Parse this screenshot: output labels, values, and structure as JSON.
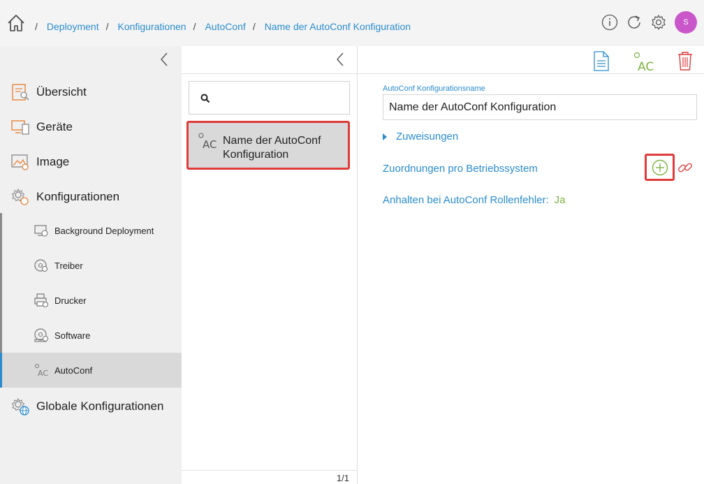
{
  "breadcrumb": {
    "items": [
      "Deployment",
      "Konfigurationen",
      "AutoConf",
      "Name der AutoConf Konfiguration"
    ],
    "separator": "/"
  },
  "header": {
    "icons": [
      "info-icon",
      "refresh-icon",
      "gear-icon"
    ],
    "avatar_initial": "S",
    "avatar_color": "#c957c9"
  },
  "sidebar": {
    "items": [
      {
        "label": "Übersicht",
        "icon": "overview-icon"
      },
      {
        "label": "Geräte",
        "icon": "devices-icon"
      },
      {
        "label": "Image",
        "icon": "image-icon"
      },
      {
        "label": "Konfigurationen",
        "icon": "configurations-icon"
      }
    ],
    "subitems": [
      {
        "label": "Background Deployment",
        "icon": "background-deployment-icon"
      },
      {
        "label": "Treiber",
        "icon": "driver-icon"
      },
      {
        "label": "Drucker",
        "icon": "printer-icon"
      },
      {
        "label": "Software",
        "icon": "software-icon"
      },
      {
        "label": "AutoConf",
        "icon": "autoconf-icon",
        "active": true
      }
    ],
    "bottom_item": {
      "label": "Globale Konfigurationen",
      "icon": "global-config-icon"
    }
  },
  "list": {
    "search_placeholder": "",
    "items": [
      {
        "label": "Name der AutoConf Konfiguration",
        "icon": "autoconf-icon",
        "selected": true
      }
    ],
    "pager": "1/1"
  },
  "detail": {
    "toolbar": [
      "document-icon",
      "autoconf-icon",
      "trash-icon"
    ],
    "name_label": "AutoConf Konfigurationsname",
    "name_value": "Name der AutoConf Konfiguration",
    "assignments_label": "Zuweisungen",
    "os_mappings_label": "Zuordnungen pro Betriebssystem",
    "halt_label": "Anhalten bei AutoConf Rollenfehler:",
    "halt_value": "Ja"
  },
  "colors": {
    "accent": "#2a8ccf",
    "highlight": "#e03a3a",
    "success": "#7cb342",
    "icon_orange": "#e8833a"
  }
}
